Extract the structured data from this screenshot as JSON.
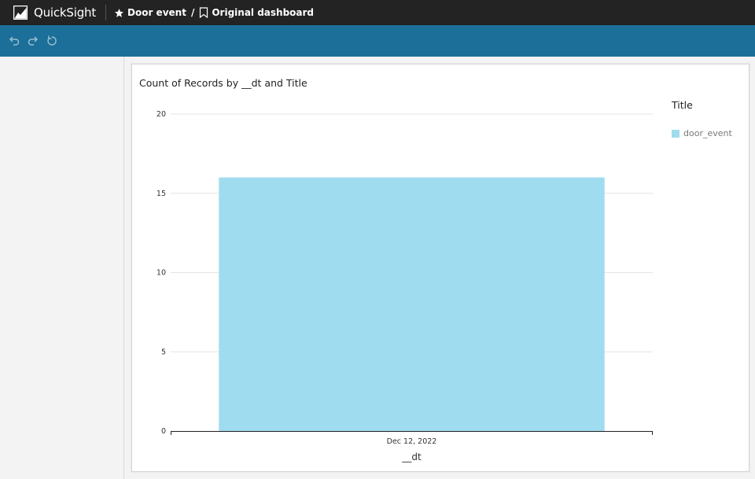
{
  "app": {
    "name": "QuickSight"
  },
  "breadcrumb": {
    "analysis": "Door event",
    "separator": "/",
    "dashboard": "Original dashboard"
  },
  "toolbar": {
    "icons": [
      "undo-icon",
      "redo-icon",
      "reset-icon"
    ]
  },
  "visual": {
    "title": "Count of Records by __dt and Title",
    "legend_title": "Title",
    "legend_item": "door_event"
  },
  "colors": {
    "topbar": "#232323",
    "toolbar": "#1b6f99",
    "bar": "#a0dcef"
  },
  "chart_data": {
    "type": "bar",
    "title": "Count of Records by __dt and Title",
    "xlabel": "__dt",
    "ylabel": "",
    "categories": [
      "Dec 12, 2022"
    ],
    "series": [
      {
        "name": "door_event",
        "values": [
          16
        ]
      }
    ],
    "ylim": [
      0,
      20
    ],
    "yticks": [
      0,
      5,
      10,
      15,
      20
    ],
    "grid": true,
    "legend": {
      "title": "Title",
      "placement": "right"
    }
  }
}
